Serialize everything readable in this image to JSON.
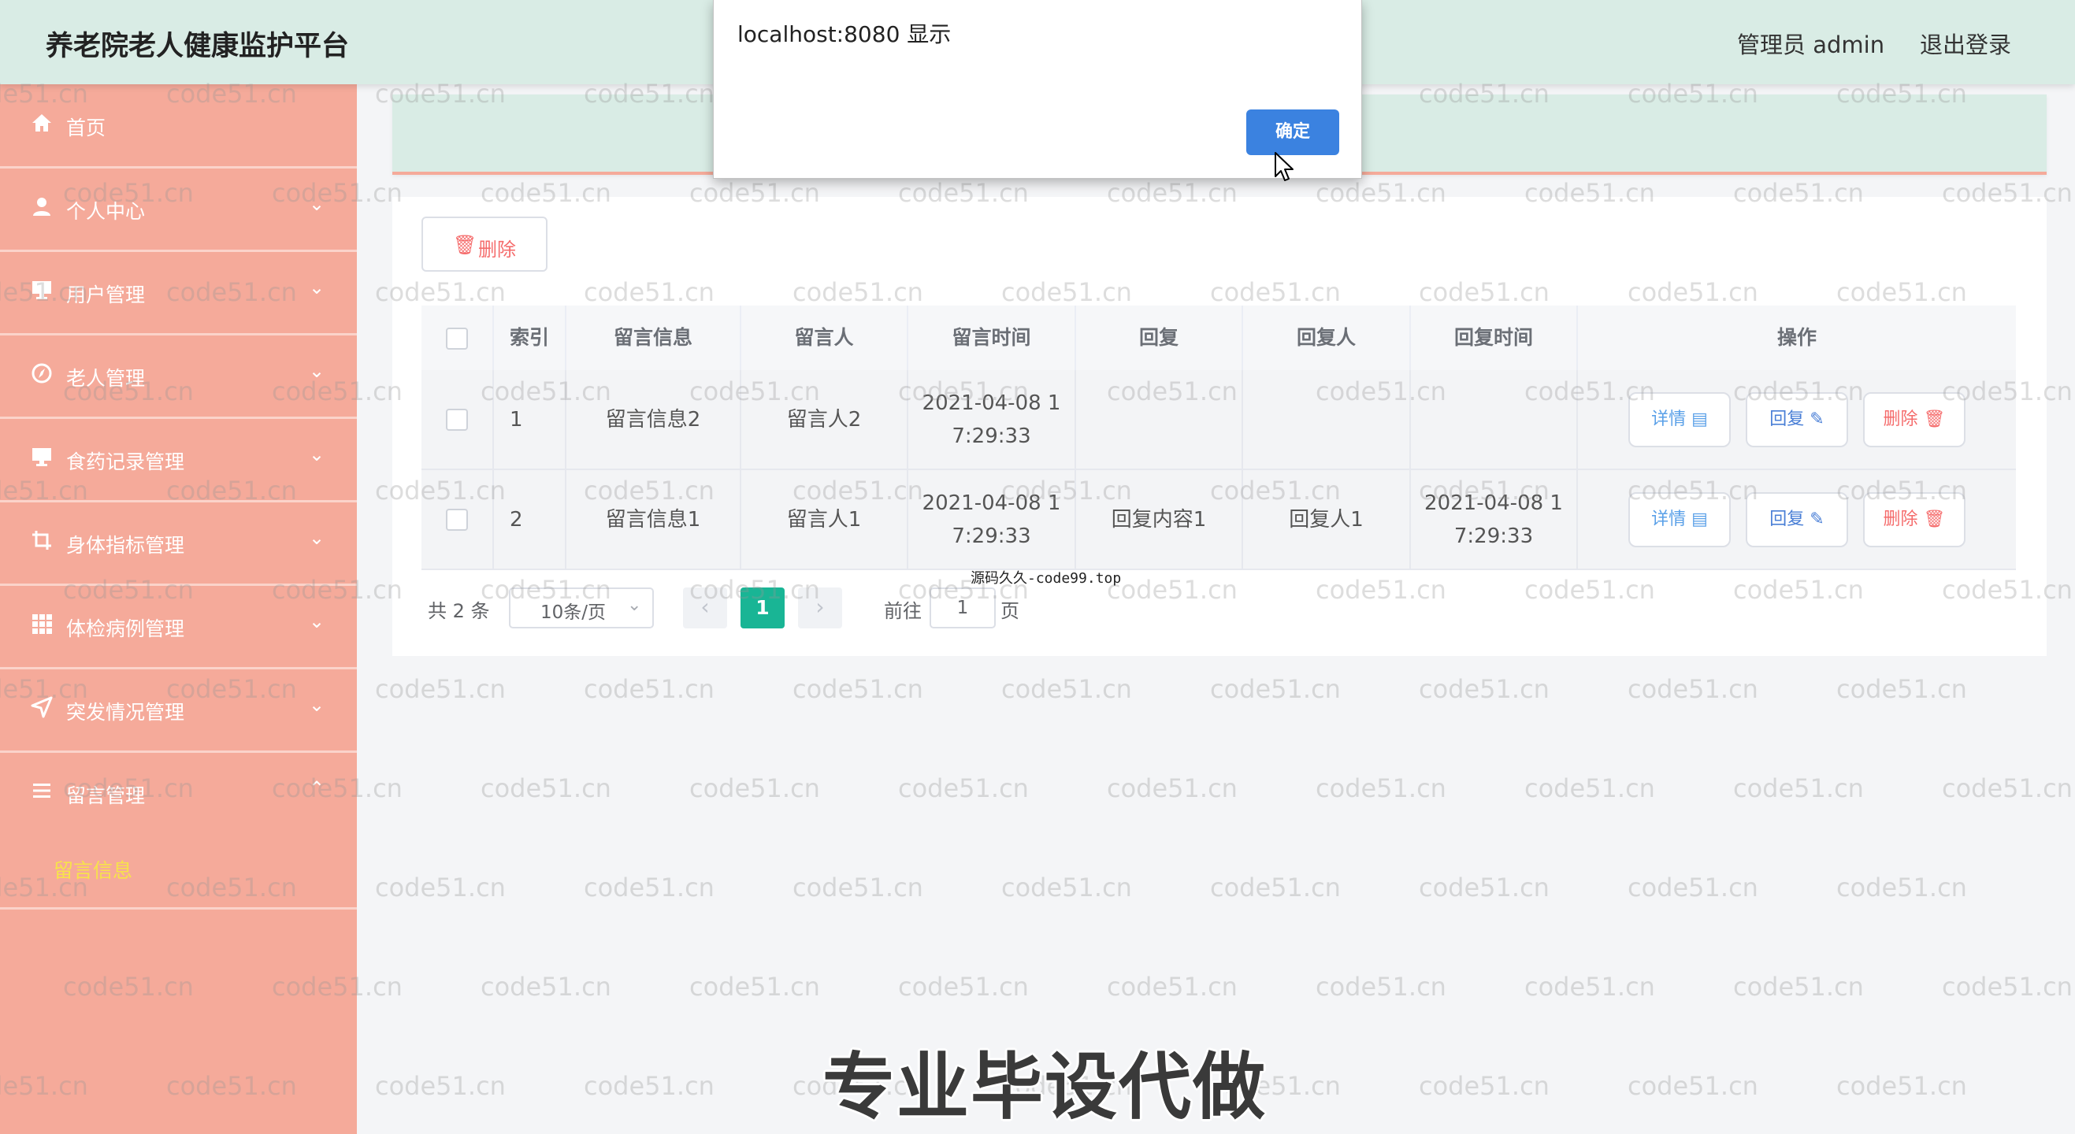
{
  "header": {
    "title": "养老院老人健康监护平台",
    "user_label": "管理员 admin",
    "logout_label": "退出登录"
  },
  "sidebar": {
    "items": [
      {
        "label": "首页",
        "icon": "home-icon",
        "has_arrow": false
      },
      {
        "label": "个人中心",
        "icon": "user-icon",
        "has_arrow": true
      },
      {
        "label": "用户管理",
        "icon": "monitor-icon",
        "has_arrow": true
      },
      {
        "label": "老人管理",
        "icon": "compass-icon",
        "has_arrow": true
      },
      {
        "label": "食药记录管理",
        "icon": "monitor-icon",
        "has_arrow": true
      },
      {
        "label": "身体指标管理",
        "icon": "crop-icon",
        "has_arrow": true
      },
      {
        "label": "体检病例管理",
        "icon": "grid-icon",
        "has_arrow": true
      },
      {
        "label": "突发情况管理",
        "icon": "navigation-icon",
        "has_arrow": true
      },
      {
        "label": "留言管理",
        "icon": "list-icon",
        "has_arrow": true
      }
    ],
    "active_sub_item": "留言信息"
  },
  "toolbar": {
    "delete_label": "删除"
  },
  "table": {
    "columns": [
      "索引",
      "留言信息",
      "留言人",
      "留言时间",
      "回复",
      "回复人",
      "回复时间",
      "操作"
    ],
    "rows": [
      {
        "index": "1",
        "message": "留言信息2",
        "author": "留言人2",
        "time_line1": "2021-04-08 1",
        "time_line2": "7:29:33",
        "reply": "",
        "replier": "",
        "reply_time_line1": "",
        "reply_time_line2": ""
      },
      {
        "index": "2",
        "message": "留言信息1",
        "author": "留言人1",
        "time_line1": "2021-04-08 1",
        "time_line2": "7:29:33",
        "reply": "回复内容1",
        "replier": "回复人1",
        "reply_time_line1": "2021-04-08 1",
        "reply_time_line2": "7:29:33"
      }
    ],
    "actions": {
      "detail": "详情",
      "reply": "回复",
      "delete": "删除"
    }
  },
  "pagination": {
    "total": "共 2 条",
    "page_size": "10条/页",
    "current_page": "1",
    "goto_label": "前往",
    "goto_value": "1",
    "page_suffix": "页"
  },
  "dialog": {
    "title": "localhost:8080 显示",
    "ok_label": "确定"
  },
  "overlays": {
    "watermark": "code51.cn",
    "small_caption": "源码久久-code99.top",
    "big_caption": "专业毕设代做"
  },
  "colors": {
    "header_bg": "#d9ece5",
    "sidebar_bg": "#f5aa9a",
    "active_sub_item": "#f7e34a",
    "primary_page": "#19b595",
    "dialog_button": "#3b82e0",
    "danger": "#f56c6c"
  }
}
